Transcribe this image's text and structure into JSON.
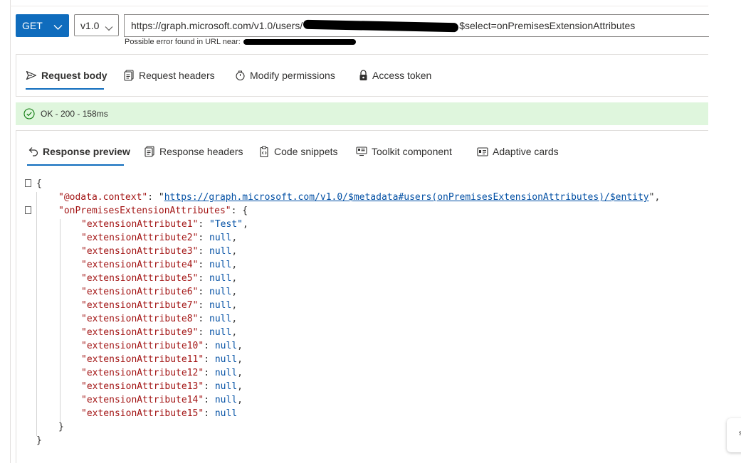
{
  "query": {
    "method": "GET",
    "version": "v1.0",
    "url_prefix": "https://graph.microsoft.com/v1.0/users/",
    "url_suffix": "$select=onPremisesExtensionAttributes",
    "error_label": "Possible error found in URL near:"
  },
  "request_tabs": [
    "Request body",
    "Request headers",
    "Modify permissions",
    "Access token"
  ],
  "status": {
    "text": "OK - 200 - 158ms",
    "color": "#dff6dd"
  },
  "response_tabs": [
    "Response preview",
    "Response headers",
    "Code snippets",
    "Toolkit component",
    "Adaptive cards"
  ],
  "response": {
    "odata_key": "\"@odata.context\"",
    "odata_value": "https://graph.microsoft.com/v1.0/$metadata#users(onPremisesExtensionAttributes)/$entity",
    "ext_key": "\"onPremisesExtensionAttributes\"",
    "attributes": [
      {
        "key": "\"extensionAttribute1\"",
        "value": "\"Test\""
      },
      {
        "key": "\"extensionAttribute2\"",
        "value": "null"
      },
      {
        "key": "\"extensionAttribute3\"",
        "value": "null"
      },
      {
        "key": "\"extensionAttribute4\"",
        "value": "null"
      },
      {
        "key": "\"extensionAttribute5\"",
        "value": "null"
      },
      {
        "key": "\"extensionAttribute6\"",
        "value": "null"
      },
      {
        "key": "\"extensionAttribute7\"",
        "value": "null"
      },
      {
        "key": "\"extensionAttribute8\"",
        "value": "null"
      },
      {
        "key": "\"extensionAttribute9\"",
        "value": "null"
      },
      {
        "key": "\"extensionAttribute10\"",
        "value": "null"
      },
      {
        "key": "\"extensionAttribute11\"",
        "value": "null"
      },
      {
        "key": "\"extensionAttribute12\"",
        "value": "null"
      },
      {
        "key": "\"extensionAttribute13\"",
        "value": "null"
      },
      {
        "key": "\"extensionAttribute14\"",
        "value": "null"
      },
      {
        "key": "\"extensionAttribute15\"",
        "value": "null"
      }
    ]
  },
  "corner_widget_text": "s",
  "colors": {
    "accent": "#0f6cbd",
    "json_key": "#a31515",
    "json_value": "#0451a5"
  }
}
